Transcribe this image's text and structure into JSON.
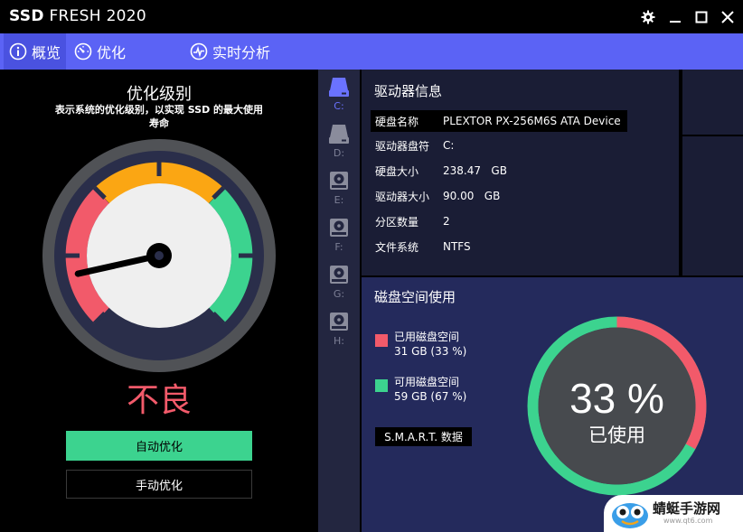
{
  "window": {
    "title_bold": "SSD",
    "title_rest": " FRESH 2020"
  },
  "nav": {
    "tabs": [
      {
        "label": "概览",
        "icon": "info-icon",
        "active": true
      },
      {
        "label": "优化",
        "icon": "speedometer-icon",
        "active": false
      },
      {
        "label": "实时分析",
        "icon": "realtime-chart-icon",
        "active": false
      }
    ]
  },
  "optimization": {
    "title": "优化级别",
    "subtitle": "表示系统的优化级别，以实现 SSD 的最大使用寿命",
    "grade": "不良",
    "auto_button": "自动优化",
    "manual_button": "手动优化",
    "gauge_level": 0.12,
    "colors": {
      "red": "#f25a6a",
      "orange": "#fba613",
      "green": "#3cd38f"
    }
  },
  "drives": [
    {
      "letter": "C:",
      "active": true
    },
    {
      "letter": "D:",
      "active": false
    },
    {
      "letter": "E:",
      "active": false
    },
    {
      "letter": "F:",
      "active": false
    },
    {
      "letter": "G:",
      "active": false
    },
    {
      "letter": "H:",
      "active": false
    }
  ],
  "drive_info": {
    "title": "驱动器信息",
    "rows": [
      {
        "key": "硬盘名称",
        "value": "PLEXTOR PX-256M6S ATA Device"
      },
      {
        "key": "驱动器盘符",
        "value": "C:"
      },
      {
        "key": "硬盘大小",
        "value": "238.47   GB"
      },
      {
        "key": "驱动器大小",
        "value": "90.00   GB"
      },
      {
        "key": "分区数量",
        "value": "2"
      },
      {
        "key": "文件系统",
        "value": "NTFS"
      }
    ]
  },
  "disk_usage": {
    "title": "磁盘空间使用",
    "used_label": "已用磁盘空间",
    "used_value": "31 GB (33 %)",
    "free_label": "可用磁盘空间",
    "free_value": "59 GB (67 %)",
    "smart_button": "S.M.A.R.T. 数据",
    "percent_text": "33 %",
    "percent_caption": "已使用",
    "used_fraction": 0.33,
    "used_color": "#f25a6a",
    "free_color": "#3cd38f"
  },
  "watermark": {
    "text": "蜻蜓手游网",
    "url": "www.qt6.com"
  }
}
